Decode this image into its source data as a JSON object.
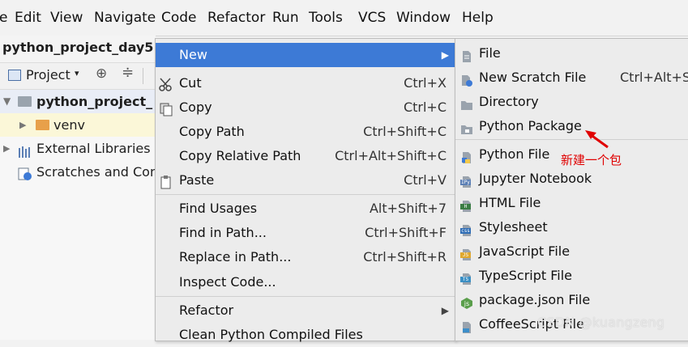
{
  "menubar": {
    "items": [
      "e",
      "Edit",
      "View",
      "Navigate",
      "Code",
      "Refactor",
      "Run",
      "Tools",
      "VCS",
      "Window",
      "Help"
    ]
  },
  "breadcrumb": {
    "project": "python_project_day5"
  },
  "project_toolbar": {
    "view_label": "Project"
  },
  "tree": {
    "root": "python_project_",
    "venv": "venv",
    "external_libraries": "External Libraries",
    "scratches": "Scratches and Con"
  },
  "context_menu": {
    "new": "New",
    "cut": {
      "label": "Cut",
      "shortcut": "Ctrl+X"
    },
    "copy": {
      "label": "Copy",
      "shortcut": "Ctrl+C"
    },
    "copy_path": {
      "label": "Copy Path",
      "shortcut": "Ctrl+Shift+C"
    },
    "copy_relative_path": {
      "label": "Copy Relative Path",
      "shortcut": "Ctrl+Alt+Shift+C"
    },
    "paste": {
      "label": "Paste",
      "shortcut": "Ctrl+V"
    },
    "find_usages": {
      "label": "Find Usages",
      "shortcut": "Alt+Shift+7"
    },
    "find_in_path": {
      "label": "Find in Path...",
      "shortcut": "Ctrl+Shift+F"
    },
    "replace_in_path": {
      "label": "Replace in Path...",
      "shortcut": "Ctrl+Shift+R"
    },
    "inspect_code": "Inspect Code...",
    "refactor": "Refactor",
    "clean_compiled": "Clean Python Compiled Files"
  },
  "submenu": {
    "file": "File",
    "new_scratch_file": {
      "label": "New Scratch File",
      "shortcut": "Ctrl+Alt+S"
    },
    "directory": "Directory",
    "python_package": "Python Package",
    "python_file": "Python File",
    "jupyter_notebook": "Jupyter Notebook",
    "html_file": "HTML File",
    "stylesheet": "Stylesheet",
    "javascript_file": "JavaScript File",
    "typescript_file": "TypeScript File",
    "package_json_file": "package.json File",
    "coffeescript_file": "CoffeeScript File"
  },
  "annotation": {
    "text": "新建一个包",
    "color": "#e00000"
  },
  "watermark": "CSDN @kuangzeng",
  "colors": {
    "highlight": "#3d7ad6",
    "menu_bg": "#ececec",
    "folder": "#9aa3ad",
    "venv_folder": "#e8a04a"
  },
  "icons": [
    "scissors-icon",
    "copy-icon",
    "paste-icon",
    "file-icon",
    "scratch-file-icon",
    "folder-icon",
    "package-icon",
    "python-file-icon",
    "jupyter-icon",
    "html-icon",
    "css-icon",
    "js-icon",
    "ts-icon",
    "package-json-icon",
    "coffeescript-icon",
    "red-arrow-icon"
  ]
}
